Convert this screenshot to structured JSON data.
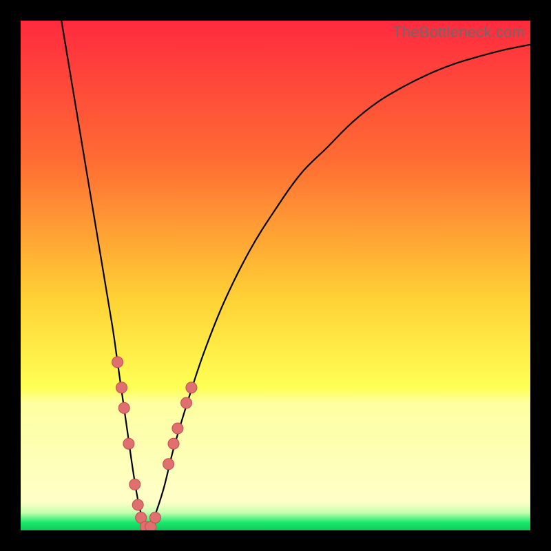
{
  "watermark": "TheBottleneck.com",
  "colors": {
    "black": "#000000",
    "curve": "#000000",
    "dot_fill": "#e06f70",
    "dot_stroke": "#c24a4c",
    "grad_top": "#ff2a3f",
    "grad_mid1": "#ff8b2e",
    "grad_mid2": "#ffd335",
    "grad_yellow": "#ffff60",
    "grad_pale": "#feffc0",
    "grad_green": "#17e86a"
  },
  "chart_data": {
    "type": "line",
    "title": "",
    "xlabel": "",
    "ylabel": "",
    "xlim": [
      0,
      100
    ],
    "ylim": [
      0,
      100
    ],
    "series": [
      {
        "name": "bottleneck-curve",
        "x": [
          8,
          10,
          12,
          14,
          16,
          18,
          19,
          20,
          21,
          22,
          23,
          24,
          25,
          26,
          28,
          30,
          33,
          36,
          40,
          45,
          50,
          55,
          60,
          65,
          70,
          75,
          80,
          85,
          90,
          95,
          100
        ],
        "y": [
          100,
          88,
          76,
          64,
          52,
          40,
          33,
          26,
          19,
          12,
          6,
          2,
          0,
          2,
          8,
          16,
          26,
          35,
          45,
          55,
          63,
          70,
          75,
          80,
          84,
          87,
          89.5,
          91.5,
          93,
          94.3,
          95.3
        ]
      }
    ],
    "scatter_points": {
      "name": "highlighted-hardware-points",
      "points": [
        {
          "x": 19.0,
          "y": 33
        },
        {
          "x": 19.8,
          "y": 28
        },
        {
          "x": 20.3,
          "y": 24
        },
        {
          "x": 21.2,
          "y": 17
        },
        {
          "x": 22.4,
          "y": 9
        },
        {
          "x": 23.0,
          "y": 5
        },
        {
          "x": 23.6,
          "y": 2.5
        },
        {
          "x": 24.5,
          "y": 0.7
        },
        {
          "x": 25.5,
          "y": 0.7
        },
        {
          "x": 26.4,
          "y": 2.5
        },
        {
          "x": 29.0,
          "y": 13
        },
        {
          "x": 30.0,
          "y": 17
        },
        {
          "x": 30.8,
          "y": 20
        },
        {
          "x": 32.5,
          "y": 25
        },
        {
          "x": 33.5,
          "y": 28
        }
      ]
    },
    "gradient_stops": [
      {
        "offset": 0.0,
        "color": "#ff2a3f"
      },
      {
        "offset": 0.28,
        "color": "#ff6e33"
      },
      {
        "offset": 0.55,
        "color": "#ffd335"
      },
      {
        "offset": 0.72,
        "color": "#ffff55"
      },
      {
        "offset": 0.75,
        "color": "#feffa0"
      },
      {
        "offset": 0.945,
        "color": "#feffc8"
      },
      {
        "offset": 0.965,
        "color": "#c7ffb0"
      },
      {
        "offset": 0.985,
        "color": "#17e86a"
      },
      {
        "offset": 1.0,
        "color": "#11c95c"
      }
    ]
  }
}
